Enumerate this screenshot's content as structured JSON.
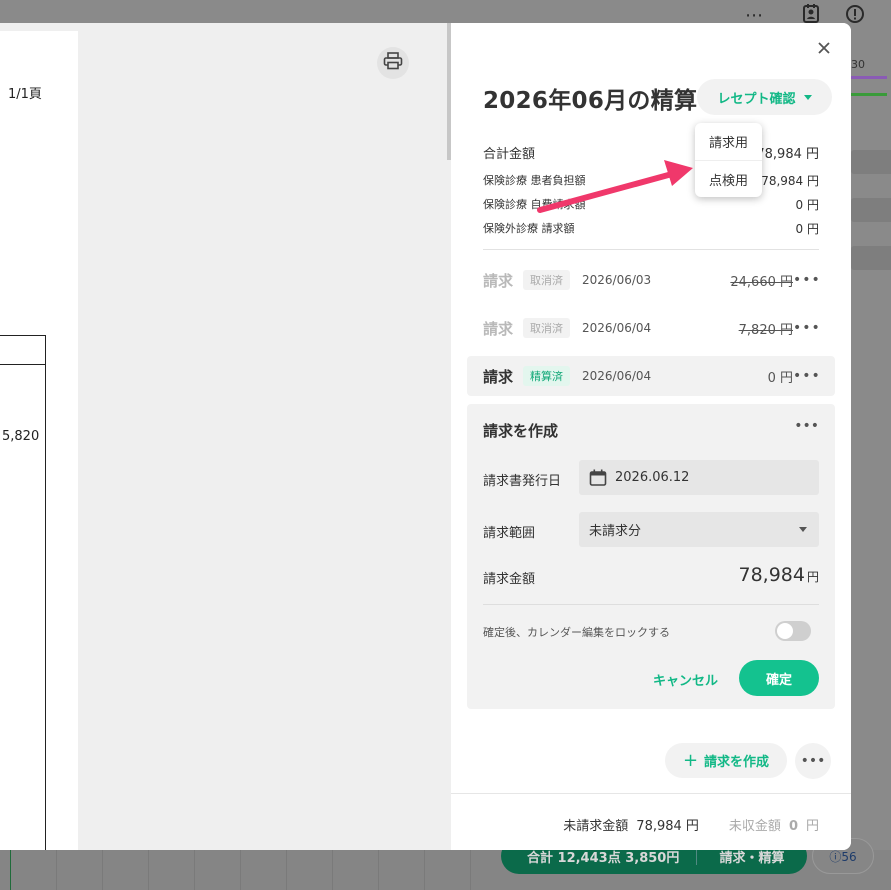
{
  "background": {
    "right_number": "30",
    "bottom_pill_left": "合計 12,443点  3,850円",
    "bottom_pill_right": "請求・精算",
    "badge": "ⓘ56"
  },
  "preview": {
    "page_label": "1/1頁",
    "table_value": "5,820"
  },
  "panel": {
    "title": "2026年06月の精算",
    "receipt_button": "レセプト確認",
    "dropdown": [
      "請求用",
      "点検用"
    ],
    "summary_main": {
      "label": "合計金額",
      "value": "78,984 円"
    },
    "summary_rows": [
      {
        "label": "保険診療 患者負担額",
        "value": "78,984 円"
      },
      {
        "label": "保険診療 自費請求額",
        "value": "0 円"
      },
      {
        "label": "保険外診療 請求額",
        "value": "0 円"
      }
    ],
    "bills": [
      {
        "title": "請求",
        "badge": "取消済",
        "date": "2026/06/03",
        "amount": "24,660 円"
      },
      {
        "title": "請求",
        "badge": "取消済",
        "date": "2026/06/04",
        "amount": "7,820 円"
      },
      {
        "title": "請求",
        "badge": "精算済",
        "date": "2026/06/04",
        "amount": "0 円"
      }
    ],
    "create": {
      "title": "請求を作成",
      "issue_date_label": "請求書発行日",
      "issue_date_value": "2026.06.12",
      "range_label": "請求範囲",
      "range_value": "未請求分",
      "amount_label": "請求金額",
      "amount_value": "78,984",
      "amount_unit": "円",
      "lock_label": "確定後、カレンダー編集をロックする",
      "cancel": "キャンセル",
      "confirm": "確定"
    },
    "add_button": "請求を作成",
    "footer": {
      "unbilled_label": "未請求金額",
      "unbilled_value": "78,984 円",
      "uncollected_label": "未収金額",
      "uncollected_value": "0",
      "uncollected_unit": "円"
    }
  },
  "colors": {
    "accent": "#12b886",
    "confirm": "#14c28f",
    "arrow": "#f0386b"
  }
}
